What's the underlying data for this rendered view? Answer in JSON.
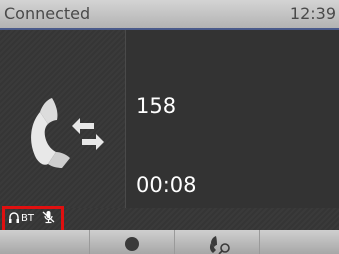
{
  "status": {
    "text": "Connected",
    "time": "12:39"
  },
  "call": {
    "number": "158",
    "duration": "00:08"
  },
  "indicators": {
    "headset_label": "BT"
  },
  "colors": {
    "status_bar": "#c4c4c4",
    "highlight": "#e01010",
    "accent_line": "#4a5a8a",
    "text": "#ffffff"
  },
  "icons": {
    "call": "handset-transfer-icon",
    "headset": "headset-icon",
    "mic_mute": "mic-mute-icon",
    "record": "record-dot-icon",
    "pickup": "handset-pickup-icon"
  }
}
